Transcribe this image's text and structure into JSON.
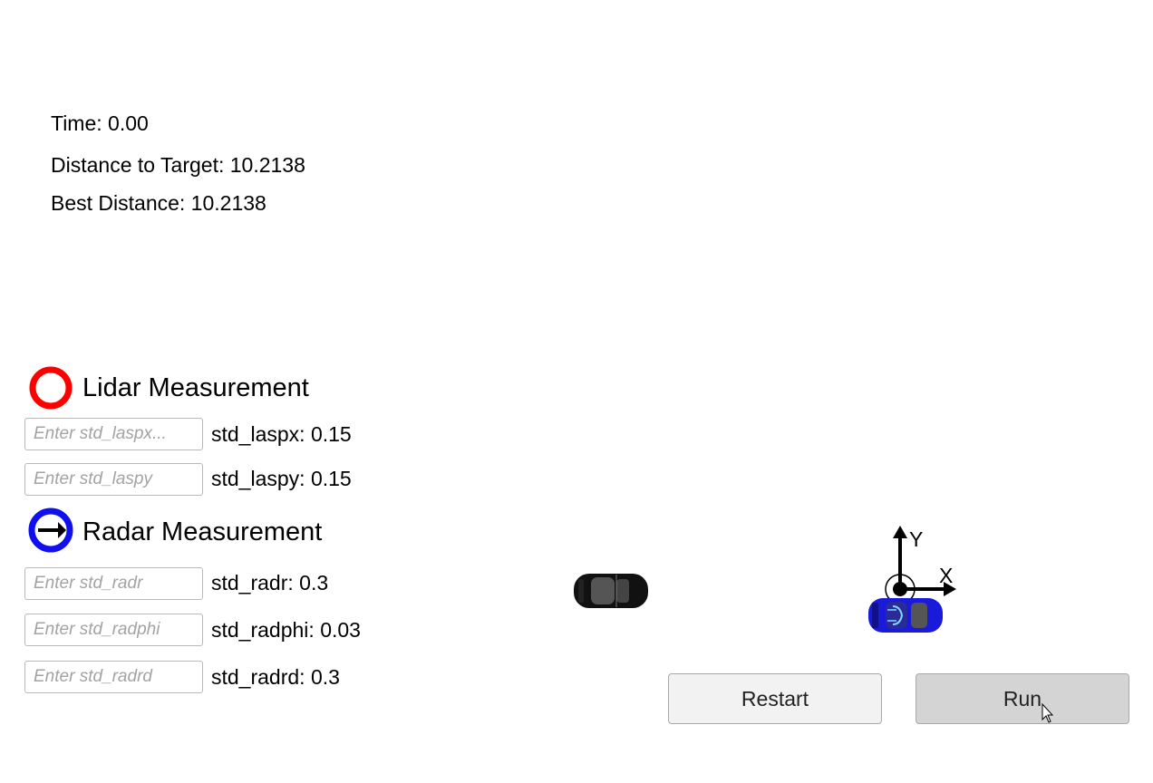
{
  "stats": {
    "time": "Time: 0.00",
    "distance": "Distance to Target: 10.2138",
    "best": "Best Distance: 10.2138"
  },
  "lidar": {
    "title": "Lidar Measurement",
    "icon": "red-circle-icon",
    "color": "#ff0000",
    "params": [
      {
        "placeholder": "Enter std_laspx...",
        "value": "",
        "label": "std_laspx: 0.15"
      },
      {
        "placeholder": "Enter std_laspy",
        "value": "",
        "label": "std_laspy: 0.15"
      }
    ]
  },
  "radar": {
    "title": "Radar Measurement",
    "icon": "blue-circle-arrow-icon",
    "color": "#0000ff",
    "params": [
      {
        "placeholder": "Enter std_radr",
        "value": "",
        "label": "std_radr: 0.3"
      },
      {
        "placeholder": "Enter std_radphi",
        "value": "",
        "label": "std_radphi: 0.03"
      },
      {
        "placeholder": "Enter std_radrd",
        "value": "",
        "label": "std_radrd: 0.3"
      }
    ]
  },
  "axes": {
    "x_label": "X",
    "y_label": "Y"
  },
  "cars": {
    "target_color": "#111111",
    "ego_color": "#1a1adb"
  },
  "buttons": {
    "restart": "Restart",
    "run": "Run"
  }
}
